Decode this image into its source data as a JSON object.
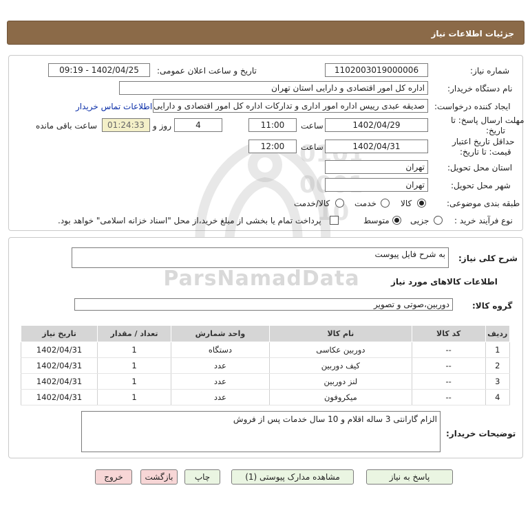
{
  "header": {
    "title": "جزئیات اطلاعات نیاز"
  },
  "form": {
    "need_number_label": "شماره نیاز:",
    "need_number": "1102003019000006",
    "announce_label": "تاریخ و ساعت اعلان عمومی:",
    "announce_value": "1402/04/25 - 09:19",
    "buyer_org_label": "نام دستگاه خریدار:",
    "buyer_org": "اداره کل امور اقتصادی و دارایی استان تهران",
    "creator_label": "ایجاد کننده درخواست:",
    "creator": "صدیقه  عبدی رییس اداره امور اداری و تدارکات اداره کل امور اقتصادی و دارایی استان",
    "contact_link": "اطلاعات تماس خریدار",
    "deadline_label_1": "مهلت ارسال پاسخ: تا",
    "deadline_label_2": "تاریخ:",
    "deadline_date": "1402/04/29",
    "time_word": "ساعت",
    "deadline_time": "11:00",
    "days_value": "4",
    "days_and": "روز و",
    "remaining_time": "01:24:33",
    "remaining_label": "ساعت باقی مانده",
    "validity_label_1": "حداقل تاریخ اعتبار",
    "validity_label_2": "قیمت: تا تاریخ:",
    "validity_date": "1402/04/31",
    "validity_time": "12:00",
    "province_label": "استان محل تحویل:",
    "province": "تهران",
    "city_label": "شهر محل تحویل:",
    "city": "تهران",
    "category_label": "طبقه بندی موضوعی:",
    "category_options": [
      "کالا",
      "خدمت",
      "کالا/خدمت"
    ],
    "category_selected": "کالا",
    "process_label": "نوع فرآیند خرید :",
    "process_options": [
      "جزیی",
      "متوسط"
    ],
    "process_selected": "متوسط",
    "payment_note": "پرداخت تمام یا بخشی از مبلغ خرید،از محل \"اسناد خزانه اسلامی\" خواهد بود."
  },
  "details": {
    "summary_label": "شرح کلی نیاز:",
    "summary": "به شرح فایل پیوست",
    "goods_info_title": "اطلاعات کالاهای مورد نیاز",
    "goods_group_label": "گروه کالا:",
    "goods_group": "دوربین،صوتی و تصویر",
    "table": {
      "headers": [
        "ردیف",
        "کد کالا",
        "نام کالا",
        "واحد شمارش",
        "تعداد / مقدار",
        "تاریخ نیاز"
      ],
      "rows": [
        [
          "1",
          "--",
          "دوربین عکاسی",
          "دستگاه",
          "1",
          "1402/04/31"
        ],
        [
          "2",
          "--",
          "کیف دوربین",
          "عدد",
          "1",
          "1402/04/31"
        ],
        [
          "3",
          "--",
          "لنز دوربین",
          "عدد",
          "1",
          "1402/04/31"
        ],
        [
          "4",
          "--",
          "میکروفون",
          "عدد",
          "1",
          "1402/04/31"
        ]
      ]
    },
    "buyer_notes_label": "توضیحات خریدار:",
    "buyer_notes": "الزام گارانتی 3 ساله اقلام و 10 سال خدمات پس از فروش"
  },
  "buttons": {
    "reply": "پاسخ به نیاز",
    "view_docs": "مشاهده مدارک پیوستی (1)",
    "print": "چاپ",
    "back": "بازگشت",
    "exit": "خروج"
  },
  "watermark": {
    "brand": "ParsNamadData"
  },
  "colors": {
    "title_bar": "#8b6a48",
    "link": "#0a2ea8",
    "button_green": "#eaf5e2",
    "button_pink": "#f7d6d6",
    "remaining_bg": "#f4f0c8"
  }
}
